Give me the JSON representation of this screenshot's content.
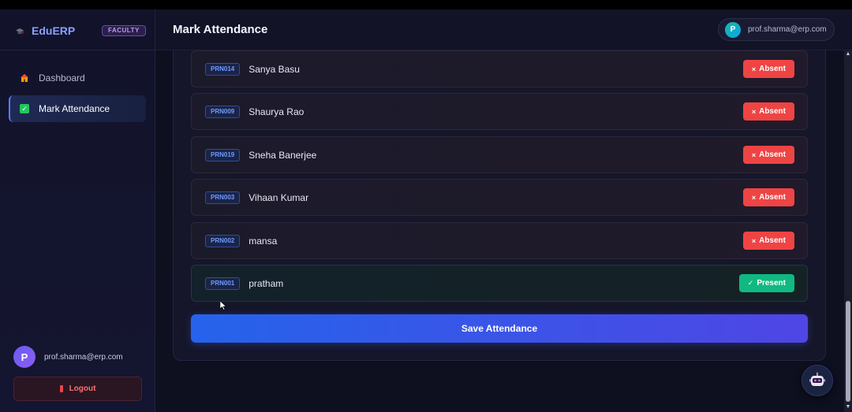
{
  "sidebar": {
    "brand": "EduERP",
    "role_badge": "FACULTY",
    "nav": [
      {
        "label": "Dashboard",
        "icon": "house-icon",
        "active": false
      },
      {
        "label": "Mark Attendance",
        "icon": "checkbox-icon",
        "active": true
      }
    ],
    "user": {
      "initial": "P",
      "email": "prof.sharma@erp.com"
    },
    "logout_label": "Logout"
  },
  "header": {
    "title": "Mark Attendance",
    "user": {
      "initial": "P",
      "email": "prof.sharma@erp.com"
    }
  },
  "attendance": {
    "students": [
      {
        "prn": "PRN014",
        "name": "Sanya Basu",
        "status": "Absent",
        "glyph": "×"
      },
      {
        "prn": "PRN009",
        "name": "Shaurya Rao",
        "status": "Absent",
        "glyph": "×"
      },
      {
        "prn": "PRN019",
        "name": "Sneha Banerjee",
        "status": "Absent",
        "glyph": "×"
      },
      {
        "prn": "PRN003",
        "name": "Vihaan Kumar",
        "status": "Absent",
        "glyph": "×"
      },
      {
        "prn": "PRN002",
        "name": "mansa",
        "status": "Absent",
        "glyph": "×"
      },
      {
        "prn": "PRN001",
        "name": "pratham",
        "status": "Present",
        "glyph": "✓"
      }
    ],
    "save_label": "Save Attendance"
  },
  "colors": {
    "accent": "#5b7cff",
    "absent": "#ef4444",
    "present": "#10b981",
    "save_gradient_start": "#2563eb",
    "save_gradient_end": "#4f46e5"
  }
}
